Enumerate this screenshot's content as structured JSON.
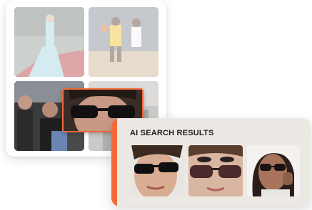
{
  "results_panel": {
    "title": "AI SEARCH RESULTS"
  },
  "grid": {
    "tiles": [
      "gown-photo",
      "basketball-photo",
      "crowd-photo",
      "event-photo"
    ]
  },
  "colors": {
    "accent": "#f26a3a",
    "panel_background": "#ece8e4",
    "title_text": "#1c1c1c"
  },
  "icons": {
    "selection": "face-crop-highlight"
  }
}
